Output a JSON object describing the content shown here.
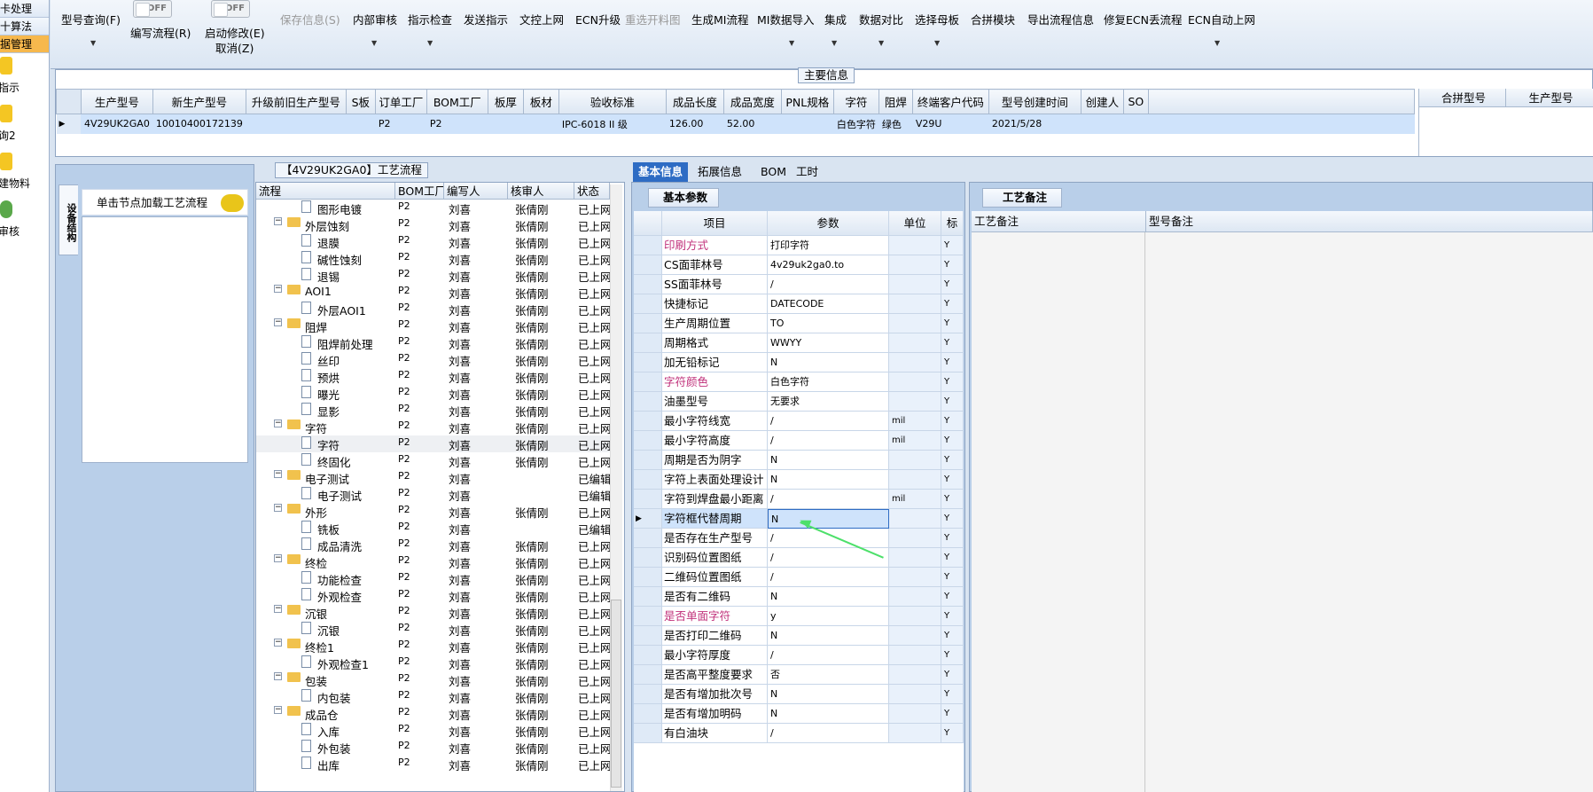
{
  "leftnav": {
    "top_items": [
      "卡处理",
      "十算法",
      "据管理"
    ],
    "items": [
      "指示",
      "询2",
      "建物料",
      "审核"
    ]
  },
  "ribbon": {
    "buttons": [
      "型号查询(F)",
      "保存信息(S)",
      "内部审核",
      "指示检查",
      "发送指示",
      "文控上网",
      "ECN升级",
      "重选开料图",
      "生成MI流程",
      "MI数据导入",
      "集成",
      "数据对比",
      "选择母板",
      "合拼模块",
      "导出流程信息",
      "修复ECN丢流程",
      "ECN自动上网"
    ],
    "toggle1": {
      "state": "OFF",
      "label": "编写流程(R)"
    },
    "toggle2": {
      "state": "OFF",
      "label": "启动修改(E)",
      "sub": "取消(Z)"
    }
  },
  "main_info": {
    "title": "主要信息",
    "columns": [
      "生产型号",
      "新生产型号",
      "升级前旧生产型号",
      "S板",
      "订单工厂",
      "BOM工厂",
      "板厚",
      "板材",
      "验收标准",
      "成品长度",
      "成品宽度",
      "PNL规格",
      "字符",
      "阻焊",
      "终端客户代码",
      "型号创建时间",
      "创建人",
      "SO"
    ],
    "row": [
      "4V29UK2GA0",
      "10010400172139",
      "",
      "",
      "P2",
      "P2",
      "",
      "",
      "IPC-6018 II 级",
      "126.00",
      "52.00",
      "",
      "白色字符",
      "绿色",
      "V29U",
      "2021/5/28",
      "",
      ""
    ],
    "merge_columns": [
      "合拼型号",
      "生产型号"
    ]
  },
  "left_panel": {
    "tab": "设备结构",
    "header": "单击节点加载工艺流程"
  },
  "process": {
    "title": "【4V29UK2GA0】工艺流程",
    "columns": [
      "流程",
      "BOM工厂",
      "编写人",
      "核审人",
      "状态"
    ],
    "rows": [
      {
        "lvl": 2,
        "name": "图形电镀",
        "bom": "P2",
        "writer": "刘喜",
        "checker": "张倩刚",
        "status": "已上网"
      },
      {
        "lvl": 1,
        "name": "外层蚀刻",
        "bom": "P2",
        "writer": "刘喜",
        "checker": "张倩刚",
        "status": "已上网"
      },
      {
        "lvl": 2,
        "name": "退膜",
        "bom": "P2",
        "writer": "刘喜",
        "checker": "张倩刚",
        "status": "已上网"
      },
      {
        "lvl": 2,
        "name": "碱性蚀刻",
        "bom": "P2",
        "writer": "刘喜",
        "checker": "张倩刚",
        "status": "已上网"
      },
      {
        "lvl": 2,
        "name": "退锡",
        "bom": "P2",
        "writer": "刘喜",
        "checker": "张倩刚",
        "status": "已上网"
      },
      {
        "lvl": 1,
        "name": "AOI1",
        "bom": "P2",
        "writer": "刘喜",
        "checker": "张倩刚",
        "status": "已上网"
      },
      {
        "lvl": 2,
        "name": "外层AOI1",
        "bom": "P2",
        "writer": "刘喜",
        "checker": "张倩刚",
        "status": "已上网"
      },
      {
        "lvl": 1,
        "name": "阻焊",
        "bom": "P2",
        "writer": "刘喜",
        "checker": "张倩刚",
        "status": "已上网"
      },
      {
        "lvl": 2,
        "name": "阻焊前处理",
        "bom": "P2",
        "writer": "刘喜",
        "checker": "张倩刚",
        "status": "已上网"
      },
      {
        "lvl": 2,
        "name": "丝印",
        "bom": "P2",
        "writer": "刘喜",
        "checker": "张倩刚",
        "status": "已上网"
      },
      {
        "lvl": 2,
        "name": "预烘",
        "bom": "P2",
        "writer": "刘喜",
        "checker": "张倩刚",
        "status": "已上网"
      },
      {
        "lvl": 2,
        "name": "曝光",
        "bom": "P2",
        "writer": "刘喜",
        "checker": "张倩刚",
        "status": "已上网"
      },
      {
        "lvl": 2,
        "name": "显影",
        "bom": "P2",
        "writer": "刘喜",
        "checker": "张倩刚",
        "status": "已上网"
      },
      {
        "lvl": 1,
        "name": "字符",
        "bom": "P2",
        "writer": "刘喜",
        "checker": "张倩刚",
        "status": "已上网"
      },
      {
        "lvl": 2,
        "name": "字符",
        "bom": "P2",
        "writer": "刘喜",
        "checker": "张倩刚",
        "status": "已上网",
        "hl": true
      },
      {
        "lvl": 2,
        "name": "终固化",
        "bom": "P2",
        "writer": "刘喜",
        "checker": "张倩刚",
        "status": "已上网"
      },
      {
        "lvl": 1,
        "name": "电子测试",
        "bom": "P2",
        "writer": "刘喜",
        "checker": "",
        "status": "已编辑"
      },
      {
        "lvl": 2,
        "name": "电子测试",
        "bom": "P2",
        "writer": "刘喜",
        "checker": "",
        "status": "已编辑"
      },
      {
        "lvl": 1,
        "name": "外形",
        "bom": "P2",
        "writer": "刘喜",
        "checker": "张倩刚",
        "status": "已上网"
      },
      {
        "lvl": 2,
        "name": "铣板",
        "bom": "P2",
        "writer": "刘喜",
        "checker": "",
        "status": "已编辑"
      },
      {
        "lvl": 2,
        "name": "成品清洗",
        "bom": "P2",
        "writer": "刘喜",
        "checker": "张倩刚",
        "status": "已上网"
      },
      {
        "lvl": 1,
        "name": "终检",
        "bom": "P2",
        "writer": "刘喜",
        "checker": "张倩刚",
        "status": "已上网"
      },
      {
        "lvl": 2,
        "name": "功能检查",
        "bom": "P2",
        "writer": "刘喜",
        "checker": "张倩刚",
        "status": "已上网"
      },
      {
        "lvl": 2,
        "name": "外观检查",
        "bom": "P2",
        "writer": "刘喜",
        "checker": "张倩刚",
        "status": "已上网"
      },
      {
        "lvl": 1,
        "name": "沉银",
        "bom": "P2",
        "writer": "刘喜",
        "checker": "张倩刚",
        "status": "已上网"
      },
      {
        "lvl": 2,
        "name": "沉银",
        "bom": "P2",
        "writer": "刘喜",
        "checker": "张倩刚",
        "status": "已上网"
      },
      {
        "lvl": 1,
        "name": "终检1",
        "bom": "P2",
        "writer": "刘喜",
        "checker": "张倩刚",
        "status": "已上网"
      },
      {
        "lvl": 2,
        "name": "外观检查1",
        "bom": "P2",
        "writer": "刘喜",
        "checker": "张倩刚",
        "status": "已上网"
      },
      {
        "lvl": 1,
        "name": "包装",
        "bom": "P2",
        "writer": "刘喜",
        "checker": "张倩刚",
        "status": "已上网"
      },
      {
        "lvl": 2,
        "name": "内包装",
        "bom": "P2",
        "writer": "刘喜",
        "checker": "张倩刚",
        "status": "已上网"
      },
      {
        "lvl": 1,
        "name": "成品仓",
        "bom": "P2",
        "writer": "刘喜",
        "checker": "张倩刚",
        "status": "已上网"
      },
      {
        "lvl": 2,
        "name": "入库",
        "bom": "P2",
        "writer": "刘喜",
        "checker": "张倩刚",
        "status": "已上网"
      },
      {
        "lvl": 2,
        "name": "外包装",
        "bom": "P2",
        "writer": "刘喜",
        "checker": "张倩刚",
        "status": "已上网"
      },
      {
        "lvl": 2,
        "name": "出库",
        "bom": "P2",
        "writer": "刘喜",
        "checker": "张倩刚",
        "status": "已上网"
      }
    ]
  },
  "tabs": [
    "基本信息",
    "拓展信息",
    "BOM",
    "工时"
  ],
  "params": {
    "subtab": "基本参数",
    "columns": [
      "项目",
      "参数",
      "单位",
      "标"
    ],
    "rows": [
      {
        "item": "印刷方式",
        "value": "打印字符",
        "unit": "",
        "flag": "Y",
        "pink": true
      },
      {
        "item": "CS面菲林号",
        "value": "4v29uk2ga0.to",
        "unit": "",
        "flag": "Y"
      },
      {
        "item": "SS面菲林号",
        "value": "/",
        "unit": "",
        "flag": "Y"
      },
      {
        "item": "快捷标记",
        "value": "DATECODE",
        "unit": "",
        "flag": "Y"
      },
      {
        "item": "生产周期位置",
        "value": "TO",
        "unit": "",
        "flag": "Y"
      },
      {
        "item": "周期格式",
        "value": "WWYY",
        "unit": "",
        "flag": "Y"
      },
      {
        "item": "加无铅标记",
        "value": "N",
        "unit": "",
        "flag": "Y"
      },
      {
        "item": "字符颜色",
        "value": "白色字符",
        "unit": "",
        "flag": "Y",
        "pink": true
      },
      {
        "item": "油墨型号",
        "value": "无要求",
        "unit": "",
        "flag": "Y"
      },
      {
        "item": "最小字符线宽",
        "value": "/",
        "unit": "mil",
        "flag": "Y"
      },
      {
        "item": "最小字符高度",
        "value": "/",
        "unit": "mil",
        "flag": "Y"
      },
      {
        "item": "周期是否为阴字",
        "value": "N",
        "unit": "",
        "flag": "Y"
      },
      {
        "item": "字符上表面处理设计",
        "value": "N",
        "unit": "",
        "flag": "Y"
      },
      {
        "item": "字符到焊盘最小距离",
        "value": "/",
        "unit": "mil",
        "flag": "Y"
      },
      {
        "item": "字符框代替周期",
        "value": "N",
        "unit": "",
        "flag": "Y",
        "sel": true
      },
      {
        "item": "是否存在生产型号",
        "value": "/",
        "unit": "",
        "flag": "Y"
      },
      {
        "item": "识别码位置图纸",
        "value": "/",
        "unit": "",
        "flag": "Y"
      },
      {
        "item": "二维码位置图纸",
        "value": "/",
        "unit": "",
        "flag": "Y"
      },
      {
        "item": "是否有二维码",
        "value": "N",
        "unit": "",
        "flag": "Y"
      },
      {
        "item": "是否单面字符",
        "value": "y",
        "unit": "",
        "flag": "Y",
        "pink": true
      },
      {
        "item": "是否打印二维码",
        "value": "N",
        "unit": "",
        "flag": "Y"
      },
      {
        "item": "最小字符厚度",
        "value": "/",
        "unit": "",
        "flag": "Y"
      },
      {
        "item": "是否高平整度要求",
        "value": "否",
        "unit": "",
        "flag": "Y"
      },
      {
        "item": "是否有增加批次号",
        "value": "N",
        "unit": "",
        "flag": "Y"
      },
      {
        "item": "是否有增加明码",
        "value": "N",
        "unit": "",
        "flag": "Y"
      },
      {
        "item": "有白油块",
        "value": "/",
        "unit": "",
        "flag": "Y"
      }
    ]
  },
  "remarks": {
    "subtab": "工艺备注",
    "columns": [
      "工艺备注",
      "型号备注"
    ]
  },
  "colors": {
    "accent": "#2e6cc4",
    "selection": "#cfe3fb",
    "pink": "#c0307a"
  }
}
